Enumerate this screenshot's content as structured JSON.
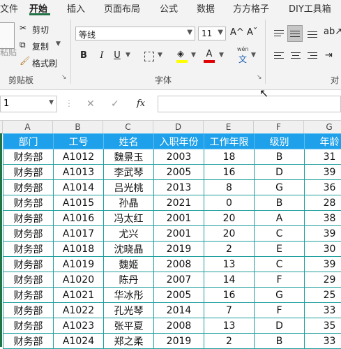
{
  "ribbon_tabs": [
    "文件",
    "开始",
    "插入",
    "页面布局",
    "公式",
    "数据",
    "方方格子",
    "DIY工具箱"
  ],
  "clipboard": {
    "paste_label": "粘贴",
    "cut_label": "剪切",
    "copy_label": "复制",
    "format_painter_label": "格式刷",
    "group_label": "剪贴板"
  },
  "font_group": {
    "font_name": "等线",
    "font_size": "11",
    "grow_label": "A^",
    "shrink_label": "Aˇ",
    "bold": "B",
    "italic": "I",
    "underline": "U",
    "font_color_letter": "A",
    "wen_label": "wén",
    "wen_char": "文",
    "group_label": "字体",
    "fill_color": "#ffff00",
    "font_color": "#e00000"
  },
  "align_group": {
    "group_label": "对"
  },
  "formula_bar": {
    "name_box": "1",
    "fx": "fx",
    "cancel": "✕",
    "enter": "✓"
  },
  "columns": [
    "A",
    "B",
    "C",
    "D",
    "E",
    "F",
    "G"
  ],
  "table": {
    "headers": [
      "部门",
      "工号",
      "姓名",
      "入职年份",
      "工作年限",
      "级别",
      "年龄"
    ],
    "rows": [
      [
        "财务部",
        "A1012",
        "魏景玉",
        "2003",
        "18",
        "B",
        "31"
      ],
      [
        "财务部",
        "A1013",
        "李武琴",
        "2005",
        "16",
        "D",
        "39"
      ],
      [
        "财务部",
        "A1014",
        "吕光桃",
        "2013",
        "8",
        "G",
        "36"
      ],
      [
        "财务部",
        "A1015",
        "孙晶",
        "2021",
        "0",
        "B",
        "28"
      ],
      [
        "财务部",
        "A1016",
        "冯太红",
        "2001",
        "20",
        "A",
        "38"
      ],
      [
        "财务部",
        "A1017",
        "尤兴",
        "2001",
        "20",
        "C",
        "39"
      ],
      [
        "财务部",
        "A1018",
        "沈晓晶",
        "2019",
        "2",
        "E",
        "30"
      ],
      [
        "财务部",
        "A1019",
        "魏姬",
        "2008",
        "13",
        "C",
        "39"
      ],
      [
        "财务部",
        "A1020",
        "陈丹",
        "2007",
        "14",
        "F",
        "29"
      ],
      [
        "财务部",
        "A1021",
        "华冰彤",
        "2005",
        "16",
        "G",
        "25"
      ],
      [
        "财务部",
        "A1022",
        "孔光琴",
        "2014",
        "7",
        "F",
        "33"
      ],
      [
        "财务部",
        "A1023",
        "张平夏",
        "2008",
        "13",
        "D",
        "35"
      ],
      [
        "财务部",
        "A1024",
        "郑之柔",
        "2019",
        "2",
        "B",
        "33"
      ]
    ]
  },
  "colors": {
    "header_fill": "#1ea0ea",
    "grid_line": "#1e9e9e",
    "accent": "#217346"
  }
}
